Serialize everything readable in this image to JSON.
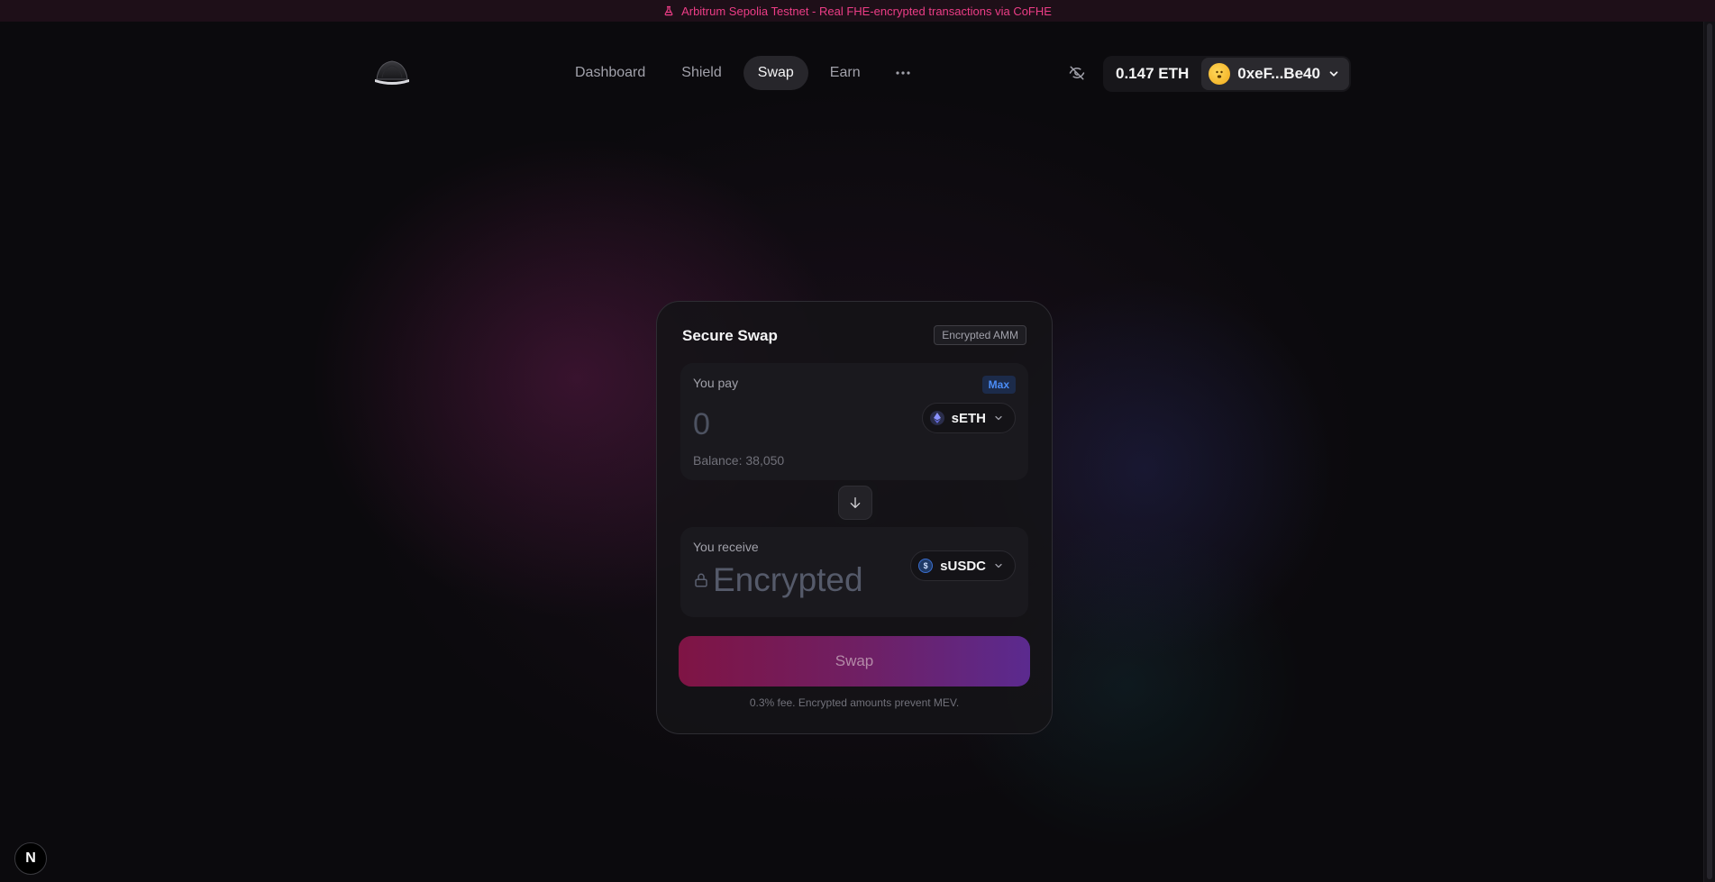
{
  "banner": {
    "icon": "flask-icon",
    "text": "Arbitrum Sepolia Testnet - Real FHE-encrypted transactions via CoFHE",
    "color": "#ec3d86"
  },
  "nav": {
    "items": [
      {
        "label": "Dashboard",
        "active": false
      },
      {
        "label": "Shield",
        "active": false
      },
      {
        "label": "Swap",
        "active": true
      },
      {
        "label": "Earn",
        "active": false
      }
    ],
    "more_label": "···"
  },
  "header": {
    "privacy_icon": "eye-off-icon",
    "eth_balance": "0.147 ETH",
    "account": "0xeF...Be40"
  },
  "swap": {
    "title": "Secure Swap",
    "badge": "Encrypted AMM",
    "pay": {
      "label": "You pay",
      "max_label": "Max",
      "placeholder": "0",
      "token": "sETH",
      "balance": "Balance: 38,050"
    },
    "receive": {
      "label": "You receive",
      "value": "Encrypted",
      "token": "sUSDC"
    },
    "button_label": "Swap",
    "fee_note": "0.3% fee. Encrypted amounts prevent MEV."
  },
  "colors": {
    "accent_pink": "#7f1444",
    "accent_purple": "#5b2a8f",
    "max_blue": "#4b8df7"
  },
  "dev_badge": "N"
}
